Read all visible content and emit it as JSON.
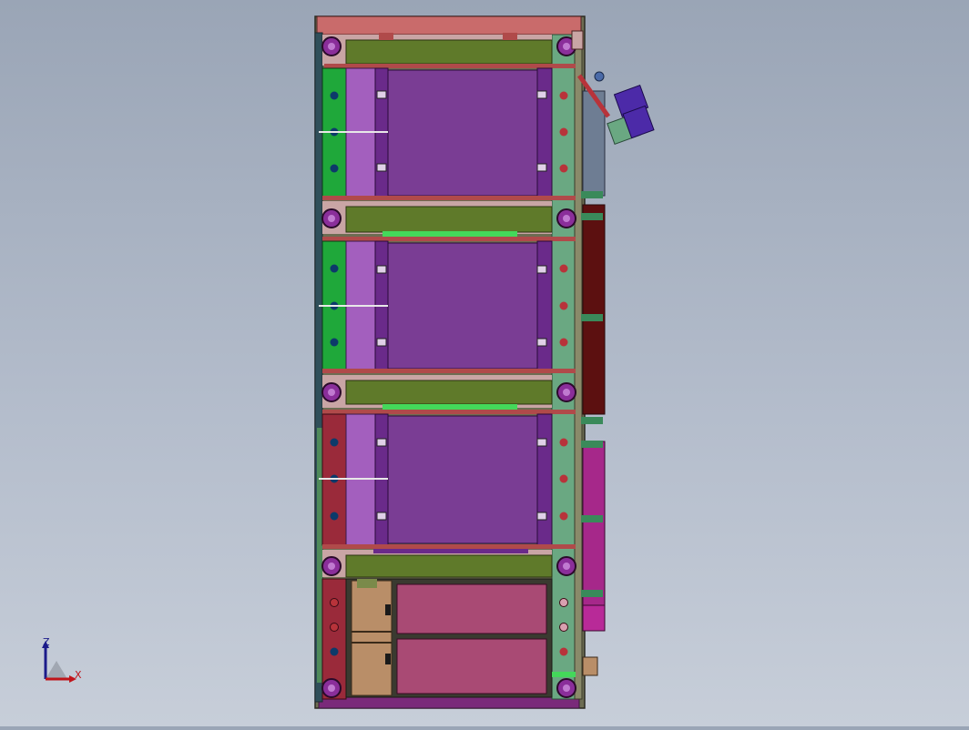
{
  "viewport": {
    "background_top": "#9aa5b6",
    "background_bottom": "#c7ced9"
  },
  "model": {
    "frame_color": "#6b6b4f",
    "top_plate_color": "#c96b6b",
    "beam_color": "#5f7a2a",
    "bearing_color": "#8a2e9a",
    "chamber_color": "#7a3d94",
    "side_rail_green": "#1fa83a",
    "side_rail_red": "#9a2a3a",
    "right_column_color": "#5fa67a",
    "drawer_color": "#a94a74",
    "cabinet_color": "#b98e68",
    "highlight_green": "#44d85a",
    "arm_block_color": "#4c2aa8",
    "magenta_panel": "#a6288a",
    "dark_red_panel": "#5c1010",
    "slate_panel": "#6e7d93"
  },
  "triad": {
    "z_label": "Z",
    "x_label": "X",
    "z_color": "#1b1b8a",
    "x_color": "#c0141a"
  }
}
